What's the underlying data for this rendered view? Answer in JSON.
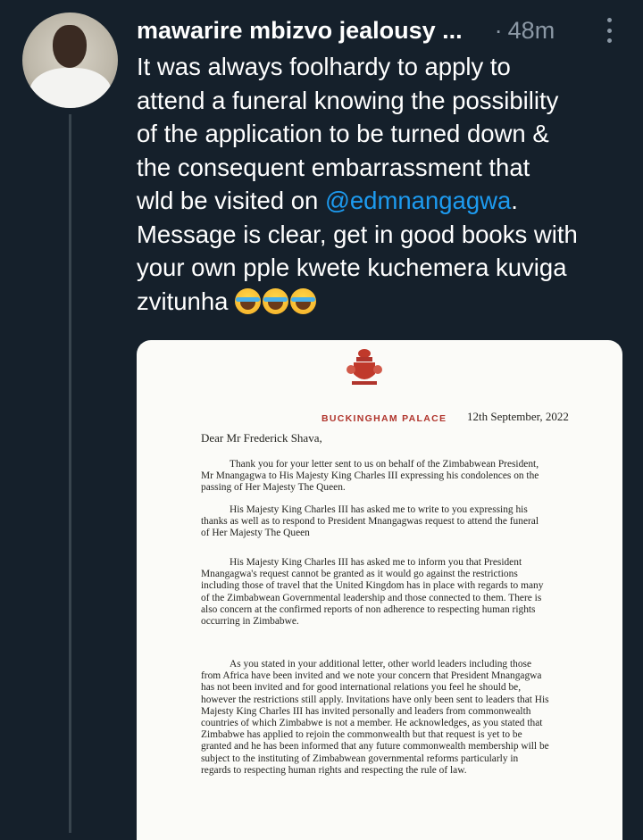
{
  "tweet": {
    "display_name": "mawarire mbizvo jealousy ...",
    "separator": "·",
    "time": "48m",
    "text_lines": [
      "It was always foolhardy to apply to",
      "attend a funeral knowing the possibility",
      "of the application to be turned down &",
      "the consequent embarrassment that"
    ],
    "line5_prefix": "wld be visited on ",
    "mention": "@edmnangagwa",
    "line5_suffix": ".",
    "text_lines_after": [
      "Message is clear, get in good books with",
      "your own pple kwete kuchemera kuviga"
    ],
    "last_line": "zvitunha ",
    "emoji_names": [
      "face-with-tears-of-joy",
      "face-with-tears-of-joy",
      "face-with-tears-of-joy"
    ]
  },
  "letter": {
    "sender": "BUCKINGHAM PALACE",
    "date": "12th September, 2022",
    "salutation": "Dear  Mr Frederick Shava,",
    "paragraphs": [
      "Thank you for your letter sent to us on behalf of the Zimbabwean President,  Mr Mnangagwa to His Majesty King Charles III expressing his condolences on the passing of Her Majesty The Queen.",
      "His Majesty King Charles III has asked me to write to you expressing his thanks as well as to respond to President Mnangagwas request to attend the funeral of Her Majesty The Queen",
      "His Majesty King Charles III has asked me to inform you that President Mnangagwa's request cannot be granted as it would go against the restrictions including those of travel that the United Kingdom has in place with regards to many of the Zimbabwean Governmental leadership and those connected to them. There is also concern at the confirmed reports of non adherence to respecting human rights occurring in Zimbabwe.",
      "As you stated in your additional letter, other world leaders including those from Africa have been invited and we note your concern that President Mnangagwa has not been invited and for good international relations you feel he should be, however the restrictions still apply. Invitations have only been sent to leaders that His Majesty King Charles III has invited personally and leaders from commonwealth countries of which Zimbabwe is not a member. He acknowledges, as you stated that Zimbabwe has applied to rejoin the commonwealth but that request is yet to be granted and he has been informed that any future commonwealth membership will be subject to the instituting of Zimbabwean governmental reforms particularly in regards to respecting human rights and respecting the rule of law."
    ]
  },
  "colors": {
    "background": "#15202b",
    "mention": "#1d9bf0",
    "muted": "#8b98a5",
    "palace_red": "#b0342c"
  },
  "icons": [
    "more-vertical-icon",
    "royal-crest-icon"
  ]
}
